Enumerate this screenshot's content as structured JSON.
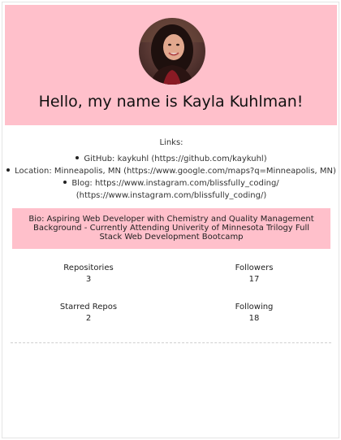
{
  "profile": {
    "greeting": "Hello, my name is Kayla Kuhlman!",
    "avatar_icon": "profile-photo"
  },
  "links": {
    "title": "Links:",
    "items": [
      {
        "text": "GitHub: kaykuhl (https://github.com/kaykuhl)"
      },
      {
        "text": "Location: Minneapolis, MN (https://www.google.com/maps?q=Minneapolis, MN)"
      },
      {
        "text": "Blog: https://www.instagram.com/blissfully_coding/",
        "text2": "(https://www.instagram.com/blissfully_coding/)"
      }
    ]
  },
  "bio": {
    "text": "Bio: Aspiring Web Developer with Chemistry and Quality Management Background - Currently Attending Univerity of Minnesota Trilogy Full Stack Web Development Bootcamp"
  },
  "stats": {
    "repositories": {
      "label": "Repositories",
      "value": "3"
    },
    "followers": {
      "label": "Followers",
      "value": "17"
    },
    "starred": {
      "label": "Starred Repos",
      "value": "2"
    },
    "following": {
      "label": "Following",
      "value": "18"
    }
  },
  "colors": {
    "accent": "#ffc0cb"
  }
}
